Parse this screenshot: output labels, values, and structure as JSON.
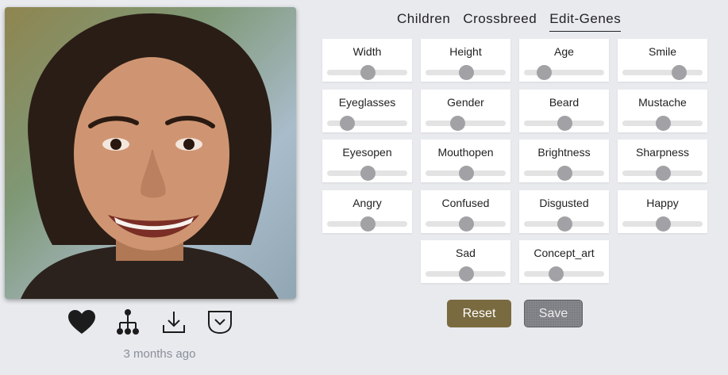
{
  "tabs": [
    {
      "label": "Children",
      "active": false
    },
    {
      "label": "Crossbreed",
      "active": false
    },
    {
      "label": "Edit-Genes",
      "active": true
    }
  ],
  "genes": [
    {
      "label": "Width",
      "value": 0.5
    },
    {
      "label": "Height",
      "value": 0.5
    },
    {
      "label": "Age",
      "value": 0.25
    },
    {
      "label": "Smile",
      "value": 0.7
    },
    {
      "label": "Eyeglasses",
      "value": 0.25
    },
    {
      "label": "Gender",
      "value": 0.4
    },
    {
      "label": "Beard",
      "value": 0.5
    },
    {
      "label": "Mustache",
      "value": 0.5
    },
    {
      "label": "Eyesopen",
      "value": 0.5
    },
    {
      "label": "Mouthopen",
      "value": 0.5
    },
    {
      "label": "Brightness",
      "value": 0.5
    },
    {
      "label": "Sharpness",
      "value": 0.5
    },
    {
      "label": "Angry",
      "value": 0.5
    },
    {
      "label": "Confused",
      "value": 0.5
    },
    {
      "label": "Disgusted",
      "value": 0.5
    },
    {
      "label": "Happy",
      "value": 0.5
    },
    {
      "label": "Sad",
      "value": 0.5
    },
    {
      "label": "Concept_art",
      "value": 0.4
    }
  ],
  "actions": {
    "icons": [
      "heart-icon",
      "family-tree-icon",
      "download-icon",
      "dropdown-icon"
    ]
  },
  "timestamp": "3 months ago",
  "buttons": {
    "reset_label": "Reset",
    "save_label": "Save"
  },
  "colors": {
    "reset_bg": "#7a6a3f",
    "save_bg": "#7c7d82",
    "slider_thumb": "#a2a2a6"
  }
}
